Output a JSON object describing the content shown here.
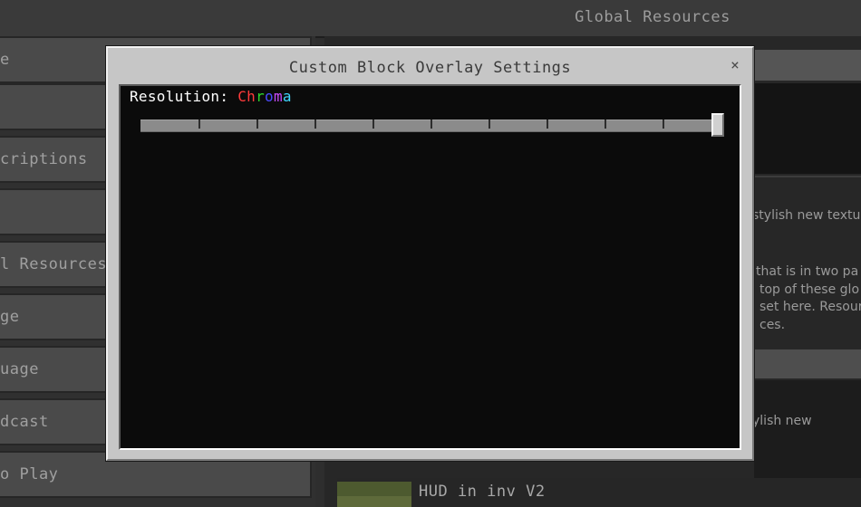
{
  "header": {
    "title": "Global Resources"
  },
  "sidebar": {
    "items": [
      {
        "label": "e"
      },
      {
        "label": ""
      },
      {
        "label": "criptions"
      },
      {
        "label": ""
      },
      {
        "label": "l Resources"
      },
      {
        "label": "ge"
      },
      {
        "label": "uage"
      },
      {
        "label": "dcast"
      },
      {
        "label": "o Play"
      }
    ]
  },
  "background_text": {
    "line1": "stylish new textu",
    "line2": "that is in two pa",
    "line3": "top of these glo",
    "line4": "set here. Resour",
    "line5": "ces.",
    "line6": "ylish new"
  },
  "pack_entry": {
    "title": "HUD in inv V2"
  },
  "modal": {
    "title": "Custom Block Overlay Settings",
    "close_symbol": "×",
    "resolution_label": "Resolution: ",
    "resolution_value_chars": [
      "C",
      "h",
      "r",
      "o",
      "m",
      "a"
    ],
    "resolution_value_colors": [
      "#ff3b3b",
      "#ff3b3b",
      "#2bd62b",
      "#4b4bff",
      "#c94bff",
      "#3fd8ff"
    ],
    "slider": {
      "steps": 9,
      "value_fraction": 1.0
    }
  }
}
